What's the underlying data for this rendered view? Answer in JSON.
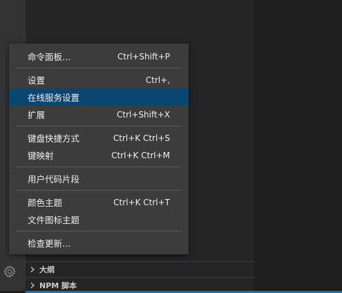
{
  "menu": {
    "groups": [
      [
        {
          "label": "命令面板...",
          "keybinding": "Ctrl+Shift+P"
        }
      ],
      [
        {
          "label": "设置",
          "keybinding": "Ctrl+,"
        },
        {
          "label": "在线服务设置",
          "keybinding": ""
        },
        {
          "label": "扩展",
          "keybinding": "Ctrl+Shift+X"
        }
      ],
      [
        {
          "label": "键盘快捷方式",
          "keybinding": "Ctrl+K Ctrl+S"
        },
        {
          "label": "键映射",
          "keybinding": "Ctrl+K Ctrl+M"
        }
      ],
      [
        {
          "label": "用户代码片段",
          "keybinding": ""
        }
      ],
      [
        {
          "label": "颜色主题",
          "keybinding": "Ctrl+K Ctrl+T"
        },
        {
          "label": "文件图标主题",
          "keybinding": ""
        }
      ],
      [
        {
          "label": "检查更新...",
          "keybinding": ""
        }
      ]
    ],
    "selected_label": "在线服务设置"
  },
  "sidebar": {
    "sections": [
      {
        "label": "大纲"
      },
      {
        "label": "NPM 脚本"
      }
    ]
  },
  "icons": {
    "manage": "gear-icon",
    "section_toggle": "chevron-right-icon"
  },
  "colors": {
    "menu_bg": "#3c3c3c",
    "selection": "#094771",
    "activity_bar": "#333333",
    "sidebar": "#252526",
    "editor": "#1e1e1e",
    "status_bar": "#007acc"
  }
}
